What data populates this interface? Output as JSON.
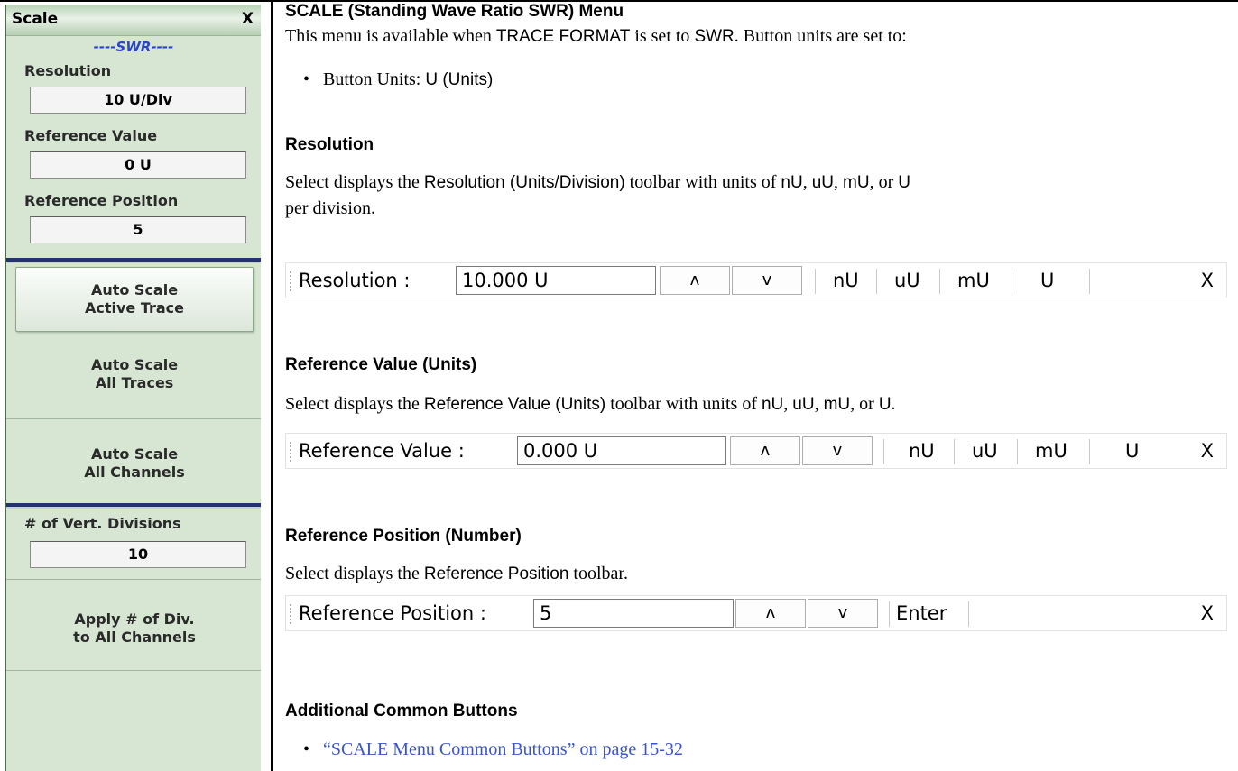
{
  "menu": {
    "title": "Scale",
    "close_label": "X",
    "mode_label": "----SWR----",
    "resolution_label": "Resolution",
    "resolution_value": "10  U/Div",
    "ref_value_label": "Reference Value",
    "ref_value_value": "0  U",
    "ref_position_label": "Reference Position",
    "ref_position_value": "5",
    "auto_active": [
      "Auto Scale",
      "Active Trace"
    ],
    "auto_all_traces": [
      "Auto Scale",
      "All Traces"
    ],
    "auto_all_channels": [
      "Auto Scale",
      "All Channels"
    ],
    "vert_div_label": "# of Vert. Divisions",
    "vert_div_value": "10",
    "apply_div": [
      "Apply # of Div.",
      "to All Channels"
    ]
  },
  "doc": {
    "title": "SCALE (Standing Wave Ratio SWR) Menu",
    "intro_a": "This menu is available when ",
    "intro_b": "TRACE FORMAT",
    "intro_c": " is set to ",
    "intro_d": "SWR",
    "intro_e": ". Button units are set to:",
    "bullet_units_a": "Button Units: ",
    "bullet_units_b": "U (Units)",
    "resolution": {
      "heading": "Resolution",
      "desc": [
        "Select displays the ",
        "Resolution (Units/Division)",
        " toolbar with units of ",
        "nU",
        ", ",
        "uU",
        ", ",
        "mU",
        ", or ",
        "U"
      ],
      "desc_line2": "per division."
    },
    "ref_value": {
      "heading": "Reference Value (Units)",
      "desc": [
        "Select displays the ",
        "Reference Value (Units)",
        " toolbar with units of ",
        "nU",
        ", ",
        "uU",
        ", ",
        "mU",
        ", or ",
        "U",
        "."
      ]
    },
    "ref_position": {
      "heading": "Reference Position (Number)",
      "desc": [
        "Select displays the ",
        "Reference Position",
        " toolbar."
      ]
    },
    "additional": {
      "heading": "Additional Common Buttons",
      "link": "“SCALE Menu Common Buttons” on page 15-32"
    }
  },
  "toolbars": {
    "resolution": {
      "label": "Resolution  :",
      "value": "10.000  U",
      "up": "^",
      "down": "v",
      "units": [
        "nU",
        "uU",
        "mU",
        "U"
      ],
      "close": "X"
    },
    "ref_value": {
      "label": "Reference Value  :",
      "value": "0.000  U",
      "up": "^",
      "down": "v",
      "units": [
        "nU",
        "uU",
        "mU",
        "U"
      ],
      "close": "X"
    },
    "ref_position": {
      "label": "Reference Position  :",
      "value": "5",
      "up": "^",
      "down": "v",
      "enter": "Enter",
      "close": "X"
    }
  }
}
